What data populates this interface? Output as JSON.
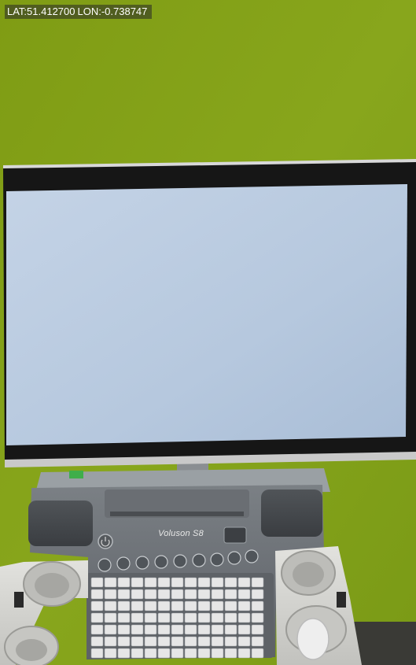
{
  "gps_overlay": {
    "latitude_label": "LAT:51.412700",
    "longitude_label": "LON:-0.738747"
  },
  "device": {
    "brand_label": "Voluson S8"
  },
  "colors": {
    "wall": "#80a018",
    "screen": "#b9cbe0",
    "console": "#6f7378",
    "keyboard_keys": "#e6e6e6",
    "cart": "#d4d4d0"
  }
}
